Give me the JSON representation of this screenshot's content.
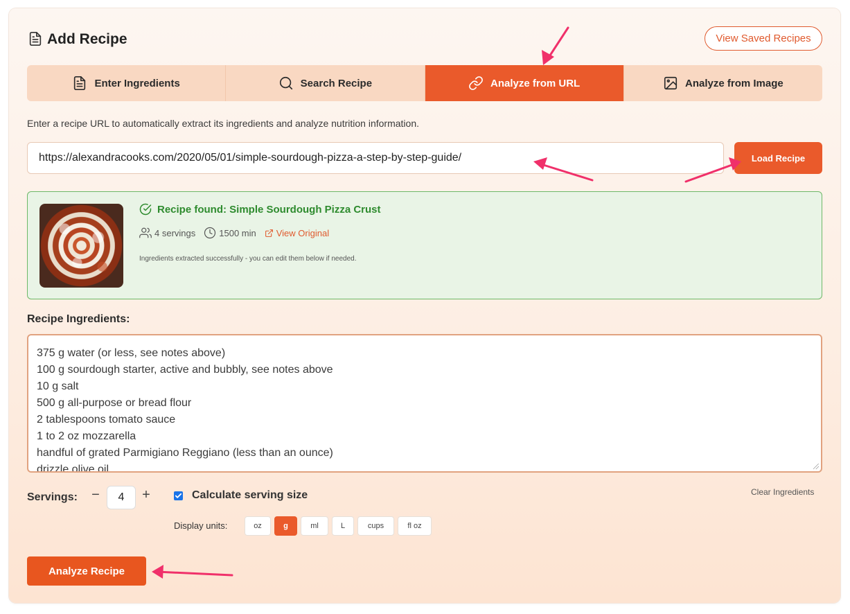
{
  "header": {
    "title": "Add Recipe",
    "view_saved_label": "View Saved Recipes"
  },
  "tabs": [
    {
      "label": "Enter Ingredients",
      "icon": "document-icon",
      "active": false
    },
    {
      "label": "Search Recipe",
      "icon": "search-icon",
      "active": false
    },
    {
      "label": "Analyze from URL",
      "icon": "link-icon",
      "active": true
    },
    {
      "label": "Analyze from Image",
      "icon": "image-icon",
      "active": false
    }
  ],
  "url_section": {
    "description": "Enter a recipe URL to automatically extract its ingredients and analyze nutrition information.",
    "url_value": "https://alexandracooks.com/2020/05/01/simple-sourdough-pizza-a-step-by-step-guide/",
    "load_button": "Load Recipe"
  },
  "recipe_found": {
    "title": "Recipe found: Simple Sourdough Pizza Crust",
    "servings": "4 servings",
    "time": "1500 min",
    "view_original": "View Original",
    "note": "Ingredients extracted successfully - you can edit them below if needed."
  },
  "ingredients": {
    "label": "Recipe Ingredients:",
    "lines": [
      "375 g water (or less, see notes above)",
      "100 g sourdough starter, active and bubbly, see notes above",
      "10 g salt",
      "500 g all-purpose or bread flour",
      "2 tablespoons tomato sauce",
      "1 to 2 oz mozzarella",
      "handful of grated Parmigiano Reggiano (less than an ounce)",
      "drizzle olive oil"
    ]
  },
  "servings": {
    "label": "Servings:",
    "minus": "−",
    "value": "4",
    "plus": "+",
    "calculate_label": "Calculate serving size",
    "calculate_checked": true,
    "clear_label": "Clear Ingredients"
  },
  "units": {
    "label": "Display units:",
    "options": [
      "oz",
      "g",
      "ml",
      "L",
      "cups",
      "fl oz"
    ],
    "selected": "g"
  },
  "analyze_button": "Analyze Recipe",
  "colors": {
    "accent": "#ea5a2b",
    "success": "#2e8b2e",
    "annotation_arrow": "#f0306a"
  }
}
